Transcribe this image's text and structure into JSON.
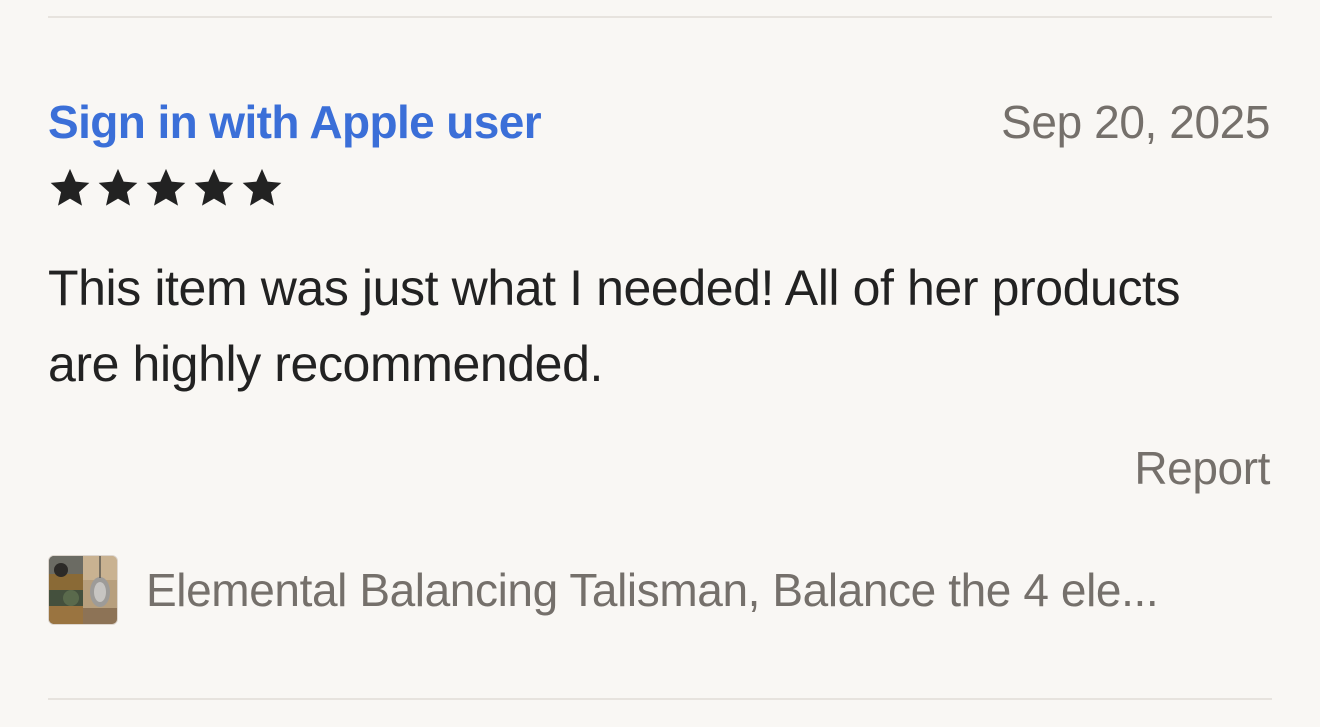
{
  "review": {
    "reviewer_name": "Sign in with Apple user",
    "date": "Sep 20, 2025",
    "rating": 5,
    "rating_max": 5,
    "text": "This item was just what I needed! All of her products are highly recommended.",
    "report_label": "Report"
  },
  "item": {
    "title": "Elemental Balancing Talisman, Balance the 4 ele...",
    "thumbnail_icon": "product-thumbnail"
  },
  "colors": {
    "reviewer_link": "#3b6fd8",
    "muted_text": "#75706b",
    "body_text": "#222222",
    "star": "#222222",
    "background": "#f9f7f4",
    "divider": "#e7e3de"
  }
}
